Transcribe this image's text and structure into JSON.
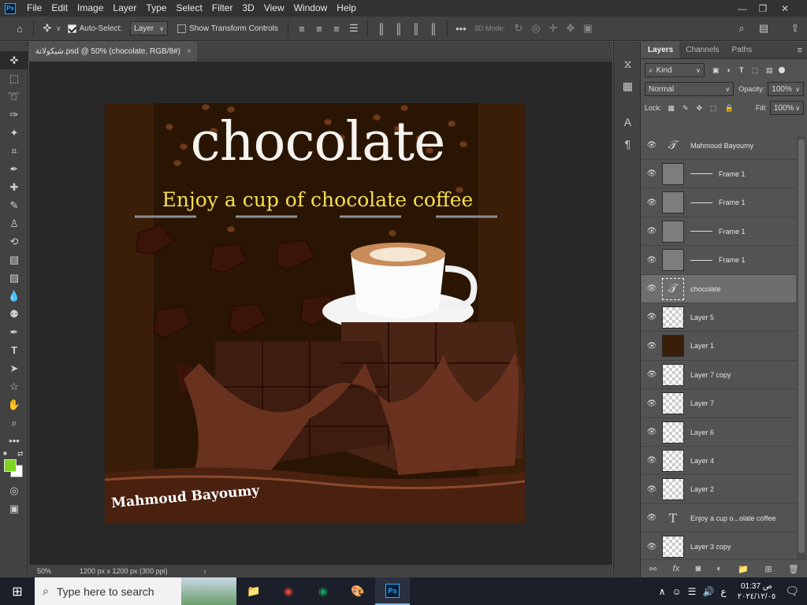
{
  "app": {
    "logo": "Ps"
  },
  "menu": [
    "File",
    "Edit",
    "Image",
    "Layer",
    "Type",
    "Select",
    "Filter",
    "3D",
    "View",
    "Window",
    "Help"
  ],
  "options": {
    "auto_select_label": "Auto-Select:",
    "auto_select_value": "Layer",
    "transform_label": "Show Transform Controls",
    "mode_3d": "3D Mode:"
  },
  "document": {
    "tab_title": "شيكولاتة.psd @ 50% (chocolate, RGB/8#)",
    "tab_close": "×",
    "zoom": "50%",
    "dimensions": "1200 px x 1200 px (300 ppi)",
    "status_arrow": "›"
  },
  "artwork": {
    "headline": "chocolate",
    "tagline": "Enjoy a cup of chocolate coffee",
    "signature": "Mahmoud Bayoumy"
  },
  "panel": {
    "tabs": [
      "Layers",
      "Channels",
      "Paths"
    ],
    "filter_kind": "Kind",
    "blend_mode": "Normal",
    "opacity_label": "Opacity:",
    "opacity_value": "100%",
    "lock_label": "Lock:",
    "fill_label": "Fill:",
    "fill_value": "100%",
    "fx_label": "fx",
    "layers": [
      {
        "name": "Mahmoud Bayoumy",
        "type": "warp-text"
      },
      {
        "name": "Frame 1",
        "type": "frame"
      },
      {
        "name": "Frame 1",
        "type": "frame"
      },
      {
        "name": "Frame 1",
        "type": "frame"
      },
      {
        "name": "Frame 1",
        "type": "frame"
      },
      {
        "name": "chocolate",
        "type": "warp-text",
        "selected": true
      },
      {
        "name": "Layer 5",
        "type": "pixel"
      },
      {
        "name": "Layer 1",
        "type": "pixel"
      },
      {
        "name": "Layer 7 copy",
        "type": "pixel"
      },
      {
        "name": "Layer 7",
        "type": "pixel"
      },
      {
        "name": "Layer 6",
        "type": "pixel"
      },
      {
        "name": "Layer 4",
        "type": "pixel"
      },
      {
        "name": "Layer 2",
        "type": "pixel"
      },
      {
        "name": "Enjoy a cup o...olate coffee",
        "type": "text"
      },
      {
        "name": "Layer 3 copy",
        "type": "pixel"
      }
    ]
  },
  "taskbar": {
    "search_placeholder": "Type here to search",
    "time": "01:37 ص",
    "date": "٢٠٢٤/١٢/٠٥",
    "lang": "ع",
    "ps_label": "Ps"
  },
  "colors": {
    "foreground": "#7ed321",
    "background": "#ffffff",
    "artboard_bg": "#3b1e07",
    "tagline": "#f4e04d",
    "selection": "#6e6e6e"
  }
}
